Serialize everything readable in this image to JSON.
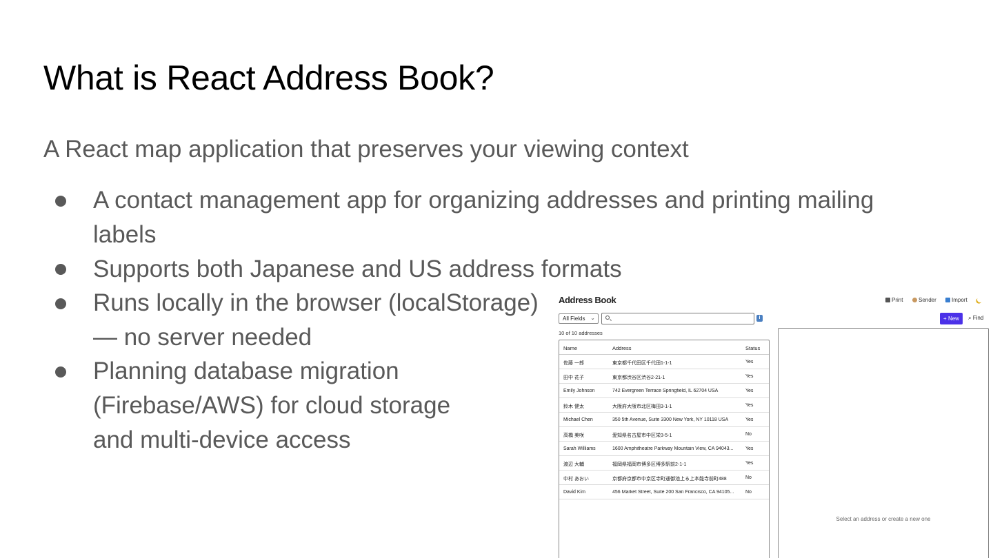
{
  "slide": {
    "title": "What is React Address Book?",
    "subtitle": "A React map application that preserves your viewing context",
    "bullets": [
      {
        "lines": [
          "A contact management app for organizing addresses and printing mailing",
          "labels"
        ]
      },
      {
        "lines": [
          "Supports both Japanese and US address formats"
        ]
      },
      {
        "lines": [
          "Runs locally in the browser (localStorage)",
          "— no server needed"
        ]
      },
      {
        "lines": [
          "Planning database migration",
          "(Firebase/AWS) for cloud storage",
          "and multi-device access"
        ]
      }
    ]
  },
  "app": {
    "title": "Address Book",
    "toolbar": {
      "print_label": "Print",
      "sender_label": "Sender",
      "import_label": "Import",
      "theme_icon": "moon-icon"
    },
    "filter": {
      "field_value": "All Fields",
      "search_value": "",
      "new_label": "+ New",
      "find_label": "Find"
    },
    "count_text": "10 of 10 addresses",
    "table": {
      "columns": [
        "Name",
        "Address",
        "Status"
      ],
      "rows": [
        {
          "name": "佐藤 一郎",
          "address": "東京都千代田区千代田1-1-1",
          "status": "Yes"
        },
        {
          "name": "田中 花子",
          "address": "東京都渋谷区渋谷2-21-1",
          "status": "Yes"
        },
        {
          "name": "Emily Johnson",
          "address": "742 Evergreen Terrace Springfield, IL 62704 USA",
          "status": "Yes"
        },
        {
          "name": "鈴木 健太",
          "address": "大阪府大阪市北区梅田3-1-1",
          "status": "Yes"
        },
        {
          "name": "Michael Chen",
          "address": "350 5th Avenue, Suite 3300 New York, NY 10118 USA",
          "status": "Yes"
        },
        {
          "name": "高橋 美咲",
          "address": "愛知県名古屋市中区栄3-5-1",
          "status": "No"
        },
        {
          "name": "Sarah Williams",
          "address": "1600 Amphitheatre Parkway Mountain View, CA 94043...",
          "status": "Yes"
        },
        {
          "name": "渡辺 大輔",
          "address": "福岡県福岡市博多区博多駅前2-1-1",
          "status": "Yes"
        },
        {
          "name": "中村 あおい",
          "address": "京都府京都市中京区寺町通御池上る上本能寺前町488",
          "status": "No"
        },
        {
          "name": "David Kim",
          "address": "456 Market Street, Suite 200 San Francisco, CA 94105...",
          "status": "No"
        }
      ]
    },
    "detail_placeholder": "Select an address or create a new one",
    "colors": {
      "accent": "#4b31e8",
      "info": "#4a7fc1",
      "text_gray": "#595959"
    }
  }
}
